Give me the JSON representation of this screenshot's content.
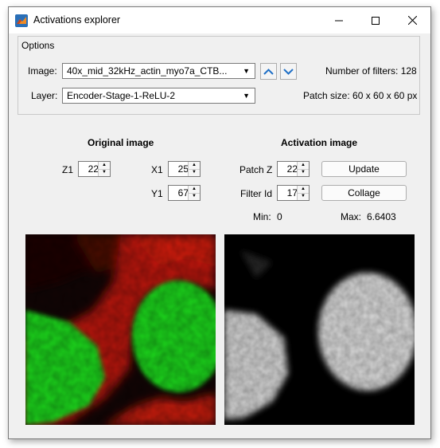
{
  "window": {
    "title": "Activations explorer"
  },
  "options": {
    "panel_title": "Options",
    "image_label": "Image:",
    "image_value": "40x_mid_32kHz_actin_myo7a_CTB...",
    "layer_label": "Layer:",
    "layer_value": "Encoder-Stage-1-ReLU-2",
    "num_filters": "Number of filters: 128",
    "patch_size": "Patch size: 60 x 60 x 60 px"
  },
  "original": {
    "title": "Original image",
    "z1_label": "Z1",
    "z1_value": "22",
    "x1_label": "X1",
    "x1_value": "25",
    "y1_label": "Y1",
    "y1_value": "67"
  },
  "activation": {
    "title": "Activation image",
    "patch_z_label": "Patch Z",
    "patch_z_value": "22",
    "filter_id_label": "Filter Id",
    "filter_id_value": "17",
    "update_label": "Update",
    "collage_label": "Collage",
    "min_label": "Min:",
    "min_value": "0",
    "max_label": "Max:",
    "max_value": "6.6403"
  },
  "colors": {
    "titlebar": "#ffffff",
    "background": "#f0f0f0",
    "accent": "#1f6fc6",
    "green": "#1ad41a",
    "red": "#d81a10"
  }
}
